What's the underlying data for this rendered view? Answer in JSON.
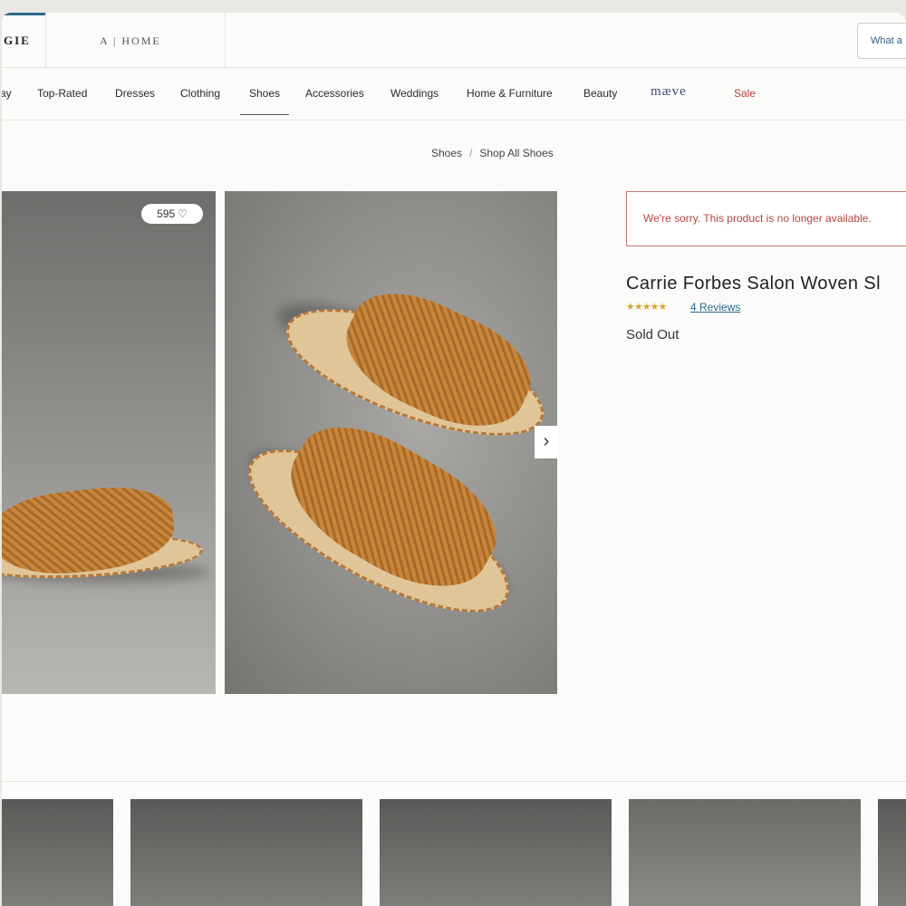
{
  "header": {
    "brand_label": "GIE",
    "home_tab_label": "A | HOME",
    "search_placeholder": "What a"
  },
  "nav": {
    "items": [
      {
        "label": "ay"
      },
      {
        "label": "Top-Rated"
      },
      {
        "label": "Dresses"
      },
      {
        "label": "Clothing"
      },
      {
        "label": "Shoes"
      },
      {
        "label": "Accessories"
      },
      {
        "label": "Weddings"
      },
      {
        "label": "Home & Furniture"
      },
      {
        "label": "Beauty"
      },
      {
        "label": "mæve"
      },
      {
        "label": "Sale"
      }
    ],
    "active": "Shoes"
  },
  "breadcrumb": {
    "items": [
      {
        "label": "Shoes"
      },
      {
        "label": "Shop All Shoes"
      }
    ],
    "separator": "/"
  },
  "gallery": {
    "likes_count": "595",
    "heart_icon": "heart-outline-icon",
    "next_icon": "chevron-right-icon"
  },
  "product": {
    "unavailable_message": "We're sorry. This product is no longer available.",
    "title": "Carrie Forbes Salon Woven Sl",
    "rating_stars": "★★★★★",
    "reviews_label": "4 Reviews",
    "status": "Sold Out"
  },
  "colors": {
    "accent": "#2c6a8b",
    "sale": "#b2443f",
    "alert_border": "#c9777a",
    "star": "#d8a634"
  }
}
